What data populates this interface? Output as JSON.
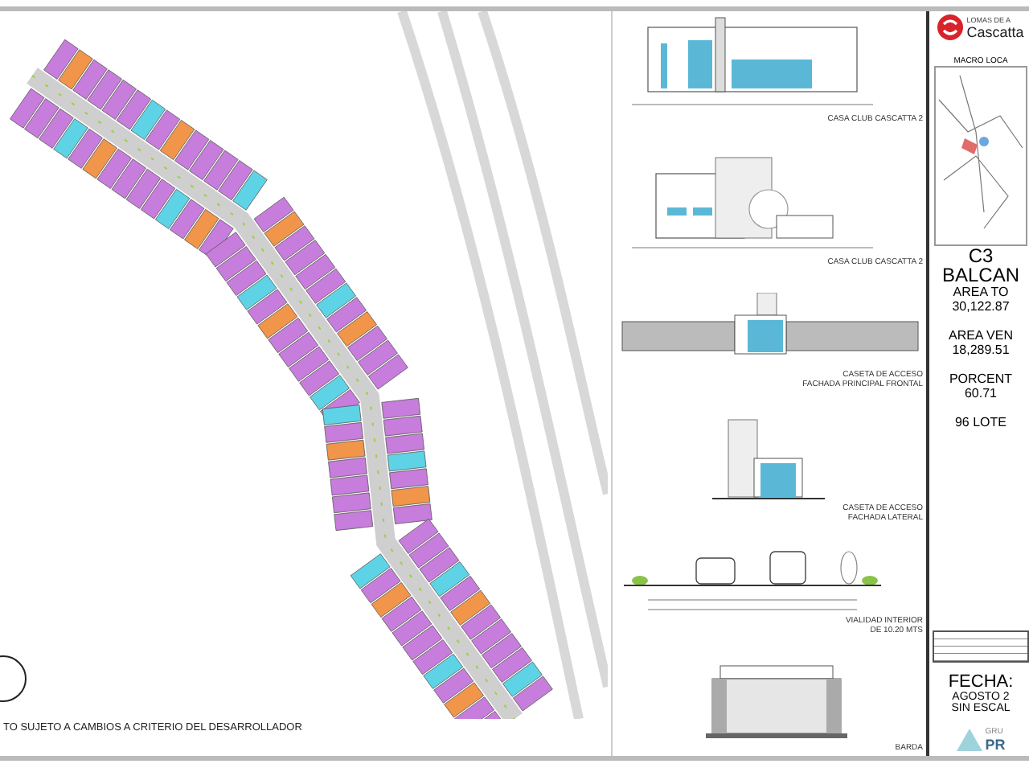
{
  "plan": {
    "disclaimer": "TO SUJETO A CAMBIOS A CRITERIO DEL DESARROLLADOR"
  },
  "elevations": [
    {
      "kind": "clubhouse_front",
      "captions": [
        "CASA CLUB CASCATTA 2"
      ]
    },
    {
      "kind": "clubhouse_side",
      "captions": [
        "CASA CLUB CASCATTA 2"
      ]
    },
    {
      "kind": "gate_front",
      "captions": [
        "CASETA DE ACCESO",
        "FACHADA PRINCIPAL FRONTAL"
      ]
    },
    {
      "kind": "gate_side",
      "captions": [
        "CASETA DE ACCESO",
        "FACHADA LATERAL"
      ]
    },
    {
      "kind": "road_section",
      "captions": [
        "VIALIDAD INTERIOR",
        "DE 10.20 MTS"
      ]
    },
    {
      "kind": "wall",
      "captions": [
        "BARDA"
      ]
    }
  ],
  "title_block": {
    "brand_line": "LOMAS DE A",
    "brand": "Cascatta",
    "map_title": "MACRO LOCA",
    "lot": "C3",
    "name": "BALCAN",
    "area_total_label": "AREA TO",
    "area_total": "30,122.87",
    "area_sale_label": "AREA VEN",
    "area_sale": "18,289.51",
    "percent_label": "PORCENT",
    "percent": "60.71",
    "lots": "96 LOTE",
    "date_label": "FECHA:",
    "date": "AGOSTO 2",
    "scale": "SIN ESCAL",
    "company_line": "GRU",
    "company": "PR"
  }
}
